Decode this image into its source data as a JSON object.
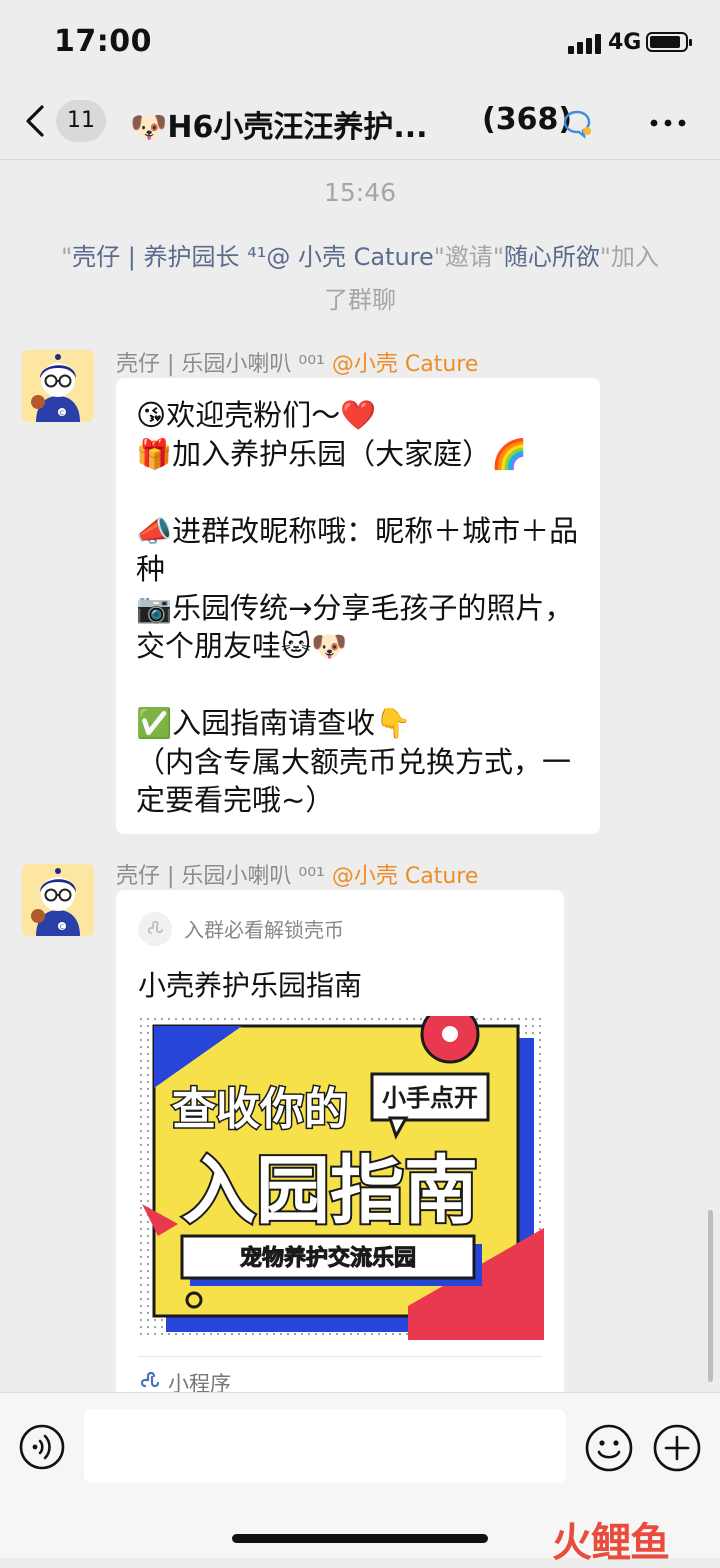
{
  "status_bar": {
    "time": "17:00",
    "network": "4G"
  },
  "nav": {
    "unread_count": "11",
    "title": "🐶H6小壳汪汪养护...",
    "member_count": "(368)"
  },
  "chat": {
    "timestamp": "15:46",
    "system_message": {
      "q1": "\"",
      "inviter": "壳仔 | 养护园长 ⁴¹@ 小壳 Cature",
      "q2": "\"邀请\"",
      "invitee": "随心所欲",
      "tail": "\"加入了群聊"
    },
    "messages": [
      {
        "sender_name": "壳仔 | 乐园小喇叭 ⁰⁰¹",
        "sender_tag": "@小壳 Cature",
        "text": "😘欢迎壳粉们～❤️\n🎁加入养护乐园（大家庭）🌈\n\n📣进群改昵称哦：昵称＋城市＋品种\n📷乐园传统→分享毛孩子的照片，交个朋友哇🐱🐶\n\n✅入园指南请查收👇\n（内含专属大额壳币兑换方式，一定要看完哦~）"
      },
      {
        "sender_name": "壳仔 | 乐园小喇叭 ⁰⁰¹",
        "sender_tag": "@小壳 Cature",
        "card": {
          "source": "入群必看解锁壳币",
          "title": "小壳养护乐园指南",
          "image_text_1": "查收你的",
          "image_badge": "小手点开",
          "image_text_2": "入园指南",
          "image_banner": "宠物养护交流乐园",
          "footer_label": "小程序"
        }
      }
    ]
  },
  "input": {
    "placeholder": ""
  },
  "watermark": "火鲤鱼",
  "colors": {
    "background": "#ededed",
    "link": "#5b6b8d",
    "at_tag": "#f08c27",
    "poster_yellow": "#f6e14a",
    "poster_blue": "#2745d8",
    "poster_red": "#e8394f"
  },
  "icons": [
    "back-chevron-icon",
    "group-chat-icon",
    "more-icon",
    "voice-icon",
    "emoji-icon",
    "plus-icon",
    "mini-program-icon"
  ]
}
